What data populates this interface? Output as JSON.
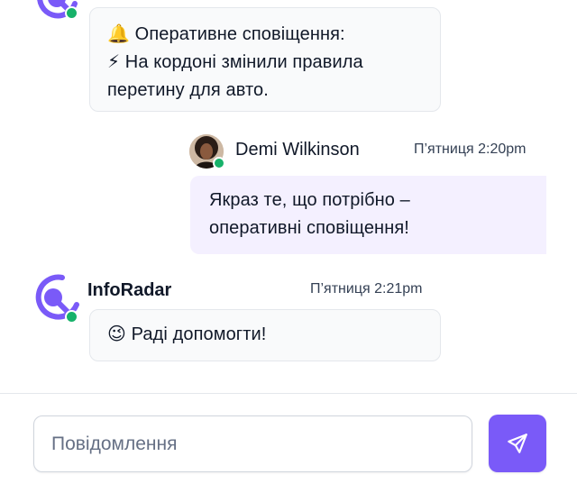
{
  "messages": [
    {
      "line1": "🔔 Оперативне сповіщення:",
      "line2": "⚡ На кордоні змінили правила",
      "line3": "перетину для авто."
    },
    {
      "sender": "Demi Wilkinson",
      "time": "П’ятниця 2:20pm",
      "line1": "Якраз те, що потрібно –",
      "line2": "оперативні сповіщення!"
    },
    {
      "sender": "InfoRadar",
      "time": "П’ятниця 2:21pm",
      "line1": "😉 Раді допомогти!"
    }
  ],
  "composer": {
    "placeholder": "Повідомлення"
  },
  "icons": {
    "bot_avatar": "inforadar-logo-icon",
    "send": "send-icon"
  },
  "colors": {
    "accent": "#7a5af8",
    "online": "#17b26a",
    "own_bubble": "#f4f0ff"
  }
}
